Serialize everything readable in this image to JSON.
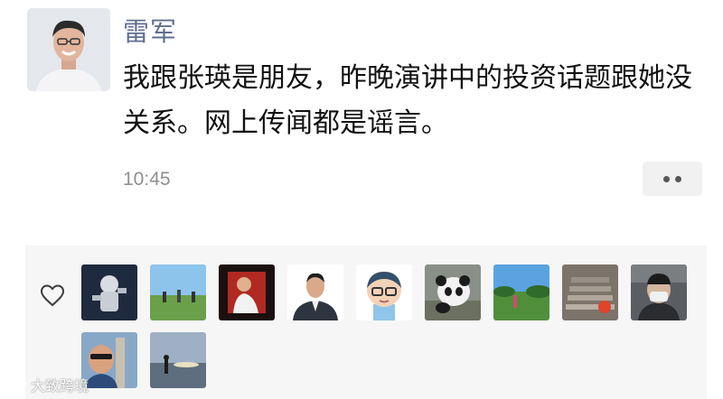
{
  "post": {
    "author_name": "雷军",
    "text": "我跟张瑛是朋友，昨晚演讲中的投资话题跟她没关系。网上传闻都是谣言。",
    "time": "10:45",
    "more_icon": "ellipsis-icon"
  },
  "likes": {
    "icon": "heart-outline-icon",
    "avatars": [
      {
        "name": "like-avatar-astronaut"
      },
      {
        "name": "like-avatar-field-people"
      },
      {
        "name": "like-avatar-red-background"
      },
      {
        "name": "like-avatar-man-suit"
      },
      {
        "name": "like-avatar-cartoon-glasses"
      },
      {
        "name": "like-avatar-panda"
      },
      {
        "name": "like-avatar-golf-course"
      },
      {
        "name": "like-avatar-stone-steps"
      },
      {
        "name": "like-avatar-man-mask"
      },
      {
        "name": "like-avatar-man-sunglasses"
      },
      {
        "name": "like-avatar-beach-sunset"
      }
    ]
  },
  "watermark": {
    "text": "大致跨境"
  },
  "colors": {
    "name": "#5f6f8e",
    "text": "#111111",
    "time": "#8f8f8f",
    "panel": "#f6f6f6"
  }
}
